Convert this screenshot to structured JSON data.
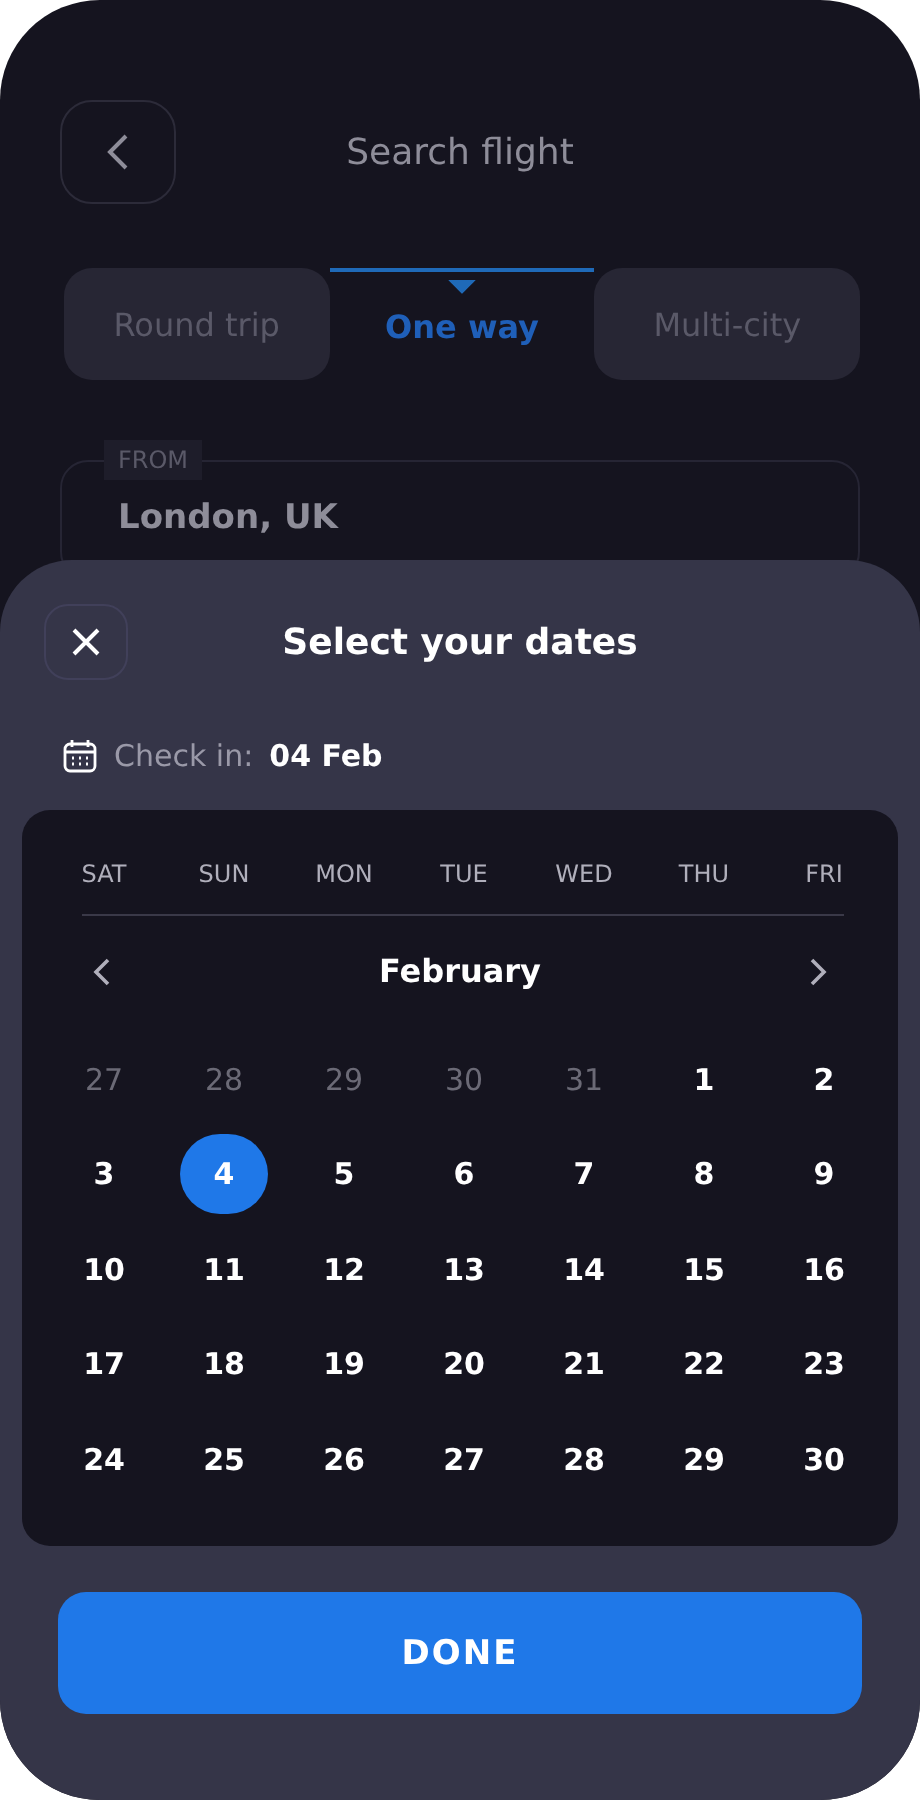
{
  "header": {
    "title": "Search flight"
  },
  "tabs": [
    {
      "label": "Round trip",
      "selected": false
    },
    {
      "label": "One way",
      "selected": true
    },
    {
      "label": "Multi-city",
      "selected": false
    }
  ],
  "from_field": {
    "label": "FROM",
    "value": "London, UK"
  },
  "sheet": {
    "title": "Select your dates",
    "check_in_label": "Check in:",
    "check_in_value": "04 Feb"
  },
  "calendar": {
    "weekdays": [
      "SAT",
      "SUN",
      "MON",
      "TUE",
      "WED",
      "THU",
      "FRI"
    ],
    "month": "February",
    "days": [
      {
        "label": "27",
        "muted": true,
        "selected": false
      },
      {
        "label": "28",
        "muted": true,
        "selected": false
      },
      {
        "label": "29",
        "muted": true,
        "selected": false
      },
      {
        "label": "30",
        "muted": true,
        "selected": false
      },
      {
        "label": "31",
        "muted": true,
        "selected": false
      },
      {
        "label": "1",
        "muted": false,
        "selected": false
      },
      {
        "label": "2",
        "muted": false,
        "selected": false
      },
      {
        "label": "3",
        "muted": false,
        "selected": false
      },
      {
        "label": "4",
        "muted": false,
        "selected": true
      },
      {
        "label": "5",
        "muted": false,
        "selected": false
      },
      {
        "label": "6",
        "muted": false,
        "selected": false
      },
      {
        "label": "7",
        "muted": false,
        "selected": false
      },
      {
        "label": "8",
        "muted": false,
        "selected": false
      },
      {
        "label": "9",
        "muted": false,
        "selected": false
      },
      {
        "label": "10",
        "muted": false,
        "selected": false
      },
      {
        "label": "11",
        "muted": false,
        "selected": false
      },
      {
        "label": "12",
        "muted": false,
        "selected": false
      },
      {
        "label": "13",
        "muted": false,
        "selected": false
      },
      {
        "label": "14",
        "muted": false,
        "selected": false
      },
      {
        "label": "15",
        "muted": false,
        "selected": false
      },
      {
        "label": "16",
        "muted": false,
        "selected": false
      },
      {
        "label": "17",
        "muted": false,
        "selected": false
      },
      {
        "label": "18",
        "muted": false,
        "selected": false
      },
      {
        "label": "19",
        "muted": false,
        "selected": false
      },
      {
        "label": "20",
        "muted": false,
        "selected": false
      },
      {
        "label": "21",
        "muted": false,
        "selected": false
      },
      {
        "label": "22",
        "muted": false,
        "selected": false
      },
      {
        "label": "23",
        "muted": false,
        "selected": false
      },
      {
        "label": "24",
        "muted": false,
        "selected": false
      },
      {
        "label": "25",
        "muted": false,
        "selected": false
      },
      {
        "label": "26",
        "muted": false,
        "selected": false
      },
      {
        "label": "27",
        "muted": false,
        "selected": false
      },
      {
        "label": "28",
        "muted": false,
        "selected": false
      },
      {
        "label": "29",
        "muted": false,
        "selected": false
      },
      {
        "label": "30",
        "muted": false,
        "selected": false
      }
    ]
  },
  "done_button": "DONE"
}
